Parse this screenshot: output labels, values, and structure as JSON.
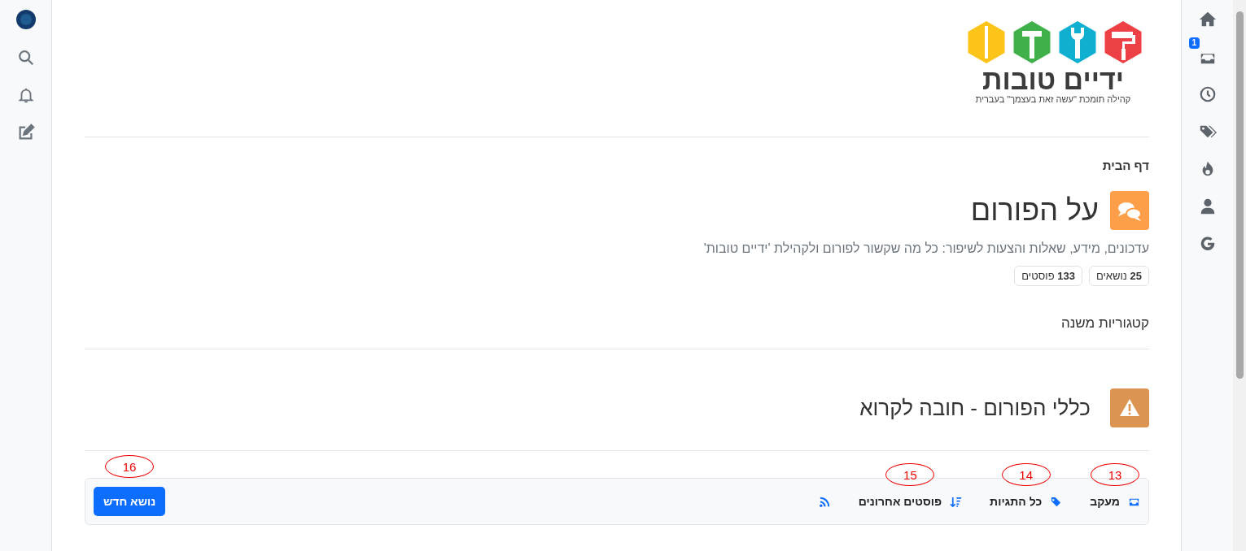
{
  "logo": {
    "title": "ידיים טובות",
    "tagline": "קהילה תומכת \"עשה זאת בעצמך\" בעברית"
  },
  "right_sidebar": {
    "inbox_badge": "1"
  },
  "breadcrumb": "דף הבית",
  "category": {
    "title": "על הפורום",
    "color": "#fd9f48",
    "description": "עדכונים, מידע, שאלות והצעות לשיפור: כל מה שקשור לפורום ולקהילת 'ידיים טובות'",
    "stats": [
      {
        "count": "25",
        "label": "נושאים"
      },
      {
        "count": "133",
        "label": "פוסטים"
      }
    ]
  },
  "subcategories_heading": "קטגוריות משנה",
  "subcategories": [
    {
      "title": "כללי הפורום - חובה לקרוא",
      "color": "#db9451"
    }
  ],
  "toolbar": {
    "items": [
      {
        "kind": "watch",
        "label": "מעקב",
        "callout": "13"
      },
      {
        "kind": "tags",
        "label": "כל התגיות",
        "callout": "14"
      },
      {
        "kind": "recent",
        "label": "פוסטים אחרונים",
        "callout": "15"
      },
      {
        "kind": "rss"
      }
    ],
    "new_topic_button": {
      "label": "נושא חדש",
      "callout": "16"
    }
  }
}
